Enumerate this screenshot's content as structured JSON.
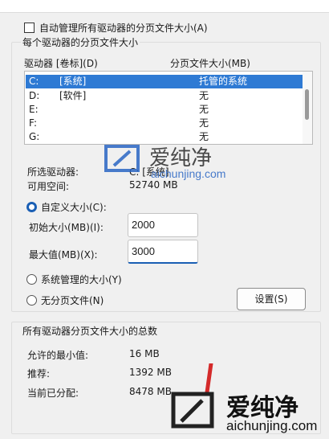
{
  "auto_manage": {
    "label": "自动管理所有驱动器的分页文件大小(A)",
    "checked": false
  },
  "per_drive": {
    "legend": "每个驱动器的分页文件大小",
    "col_drive": "驱动器 [卷标](D)",
    "col_size": "分页文件大小(MB)",
    "drives": [
      {
        "letter": "C:",
        "label": "[系统]",
        "size": "托管的系统",
        "selected": true
      },
      {
        "letter": "D:",
        "label": "[软件]",
        "size": "无",
        "selected": false
      },
      {
        "letter": "E:",
        "label": "",
        "size": "无",
        "selected": false
      },
      {
        "letter": "F:",
        "label": "",
        "size": "无",
        "selected": false
      },
      {
        "letter": "G:",
        "label": "",
        "size": "无",
        "selected": false
      }
    ],
    "selected_drive_label": "所选驱动器:",
    "selected_drive_value": "C: [系统]",
    "free_space_label": "可用空间:",
    "free_space_value": "52740 MB",
    "custom_size_label": "自定义大小(C):",
    "initial_size_label": "初始大小(MB)(I):",
    "initial_size_value": "2000",
    "max_size_label": "最大值(MB)(X):",
    "max_size_value": "3000",
    "system_managed_label": "系统管理的大小(Y)",
    "no_paging_label": "无分页文件(N)",
    "set_button": "设置(S)"
  },
  "totals": {
    "legend": "所有驱动器分页文件大小的总数",
    "min_label": "允许的最小值:",
    "min_value": "16 MB",
    "recommended_label": "推荐:",
    "recommended_value": "1392 MB",
    "current_label": "当前已分配:",
    "current_value": "8478 MB"
  },
  "watermark": {
    "brand": "爱纯净",
    "url": "aichunjing.com"
  },
  "colors": {
    "selection": "#2e7ad4",
    "accent": "#1a5fb4"
  }
}
